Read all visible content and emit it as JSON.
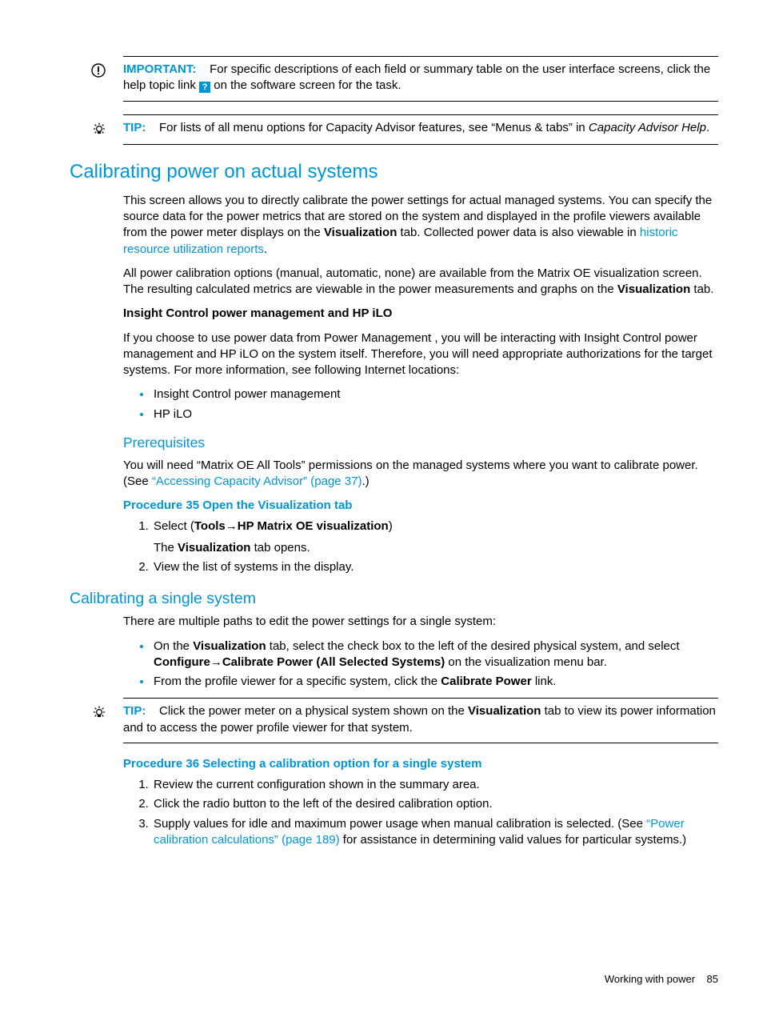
{
  "callouts": {
    "important_label": "IMPORTANT:",
    "important_body_1": "For specific descriptions of each field or summary table on the user interface screens, click the help topic link ",
    "important_body_2": " on the software screen for the task.",
    "help_badge": "?",
    "tip1_label": "TIP:",
    "tip1_body_1": "For lists of all menu options for Capacity Advisor features, see “Menus & tabs” in ",
    "tip1_body_ital": "Capacity Advisor Help",
    "tip1_body_2": ".",
    "tip2_label": "TIP:",
    "tip2_body_1": "Click the power meter on a physical system shown on the ",
    "tip2_body_bold": "Visualization",
    "tip2_body_2": " tab to view its power information and to access the power profile viewer for that system."
  },
  "sec1": {
    "title": "Calibrating power on actual systems",
    "p1_a": "This screen allows you to directly calibrate the power settings for actual managed systems. You can specify the source data for the power metrics that are stored on the system and displayed in the profile viewers available from the power meter displays on the ",
    "p1_bold": "Visualization",
    "p1_b": " tab. Collected power data is also viewable in ",
    "p1_link": "historic resource utilization reports",
    "p1_c": ".",
    "p2_a": "All power calibration options (manual, automatic, none) are available from the Matrix OE visualization screen. The resulting calculated metrics are viewable in the power measurements and graphs on the ",
    "p2_bold": "Visualization",
    "p2_b": " tab.",
    "sub_bold": "Insight Control power management and HP iLO",
    "p3": "If you choose to use power data from Power Management , you will be interacting with Insight Control power management and HP iLO on the system itself. Therefore, you will need appropriate authorizations for the target systems. For more information, see following Internet locations:",
    "bullets": [
      "Insight Control power management",
      "HP iLO"
    ],
    "prereq_title": "Prerequisites",
    "prereq_p_a": "You will need “Matrix OE All Tools” permissions on the managed systems where you want to calibrate power. (See ",
    "prereq_link": "“Accessing Capacity Advisor” (page 37)",
    "prereq_p_b": ".)",
    "proc35_title": "Procedure 35 Open the Visualization tab",
    "proc35_step1_a": "Select (",
    "proc35_step1_bold1": "Tools",
    "proc35_step1_arrow": "→",
    "proc35_step1_bold2": "HP Matrix OE visualization",
    "proc35_step1_b": ")",
    "proc35_step1_sub_a": "The ",
    "proc35_step1_sub_bold": "Visualization",
    "proc35_step1_sub_b": " tab opens.",
    "proc35_step2": "View the list of systems in the display."
  },
  "sec2": {
    "title": "Calibrating a single system",
    "p1": "There are multiple paths to edit the power settings for a single system:",
    "b1_a": "On the ",
    "b1_bold1": "Visualization",
    "b1_b": " tab, select the check box to the left of the desired physical system, and select ",
    "b1_bold2": "Configure",
    "b1_arrow": "→",
    "b1_bold3": "Calibrate Power (All Selected Systems)",
    "b1_c": " on the visualization menu bar.",
    "b2_a": "From the profile viewer for a specific system, click the ",
    "b2_bold": "Calibrate Power",
    "b2_b": " link.",
    "proc36_title": "Procedure 36 Selecting a calibration option for a single system",
    "proc36_step1": "Review the current configuration shown in the summary area.",
    "proc36_step2": "Click the radio button to the left of the desired calibration option.",
    "proc36_step3_a": "Supply values for idle and maximum power usage when manual calibration is selected. (See ",
    "proc36_step3_link": "“Power calibration calculations” (page 189)",
    "proc36_step3_b": " for assistance in determining valid values for particular systems.)"
  },
  "footer": {
    "text": "Working with power",
    "page": "85"
  }
}
